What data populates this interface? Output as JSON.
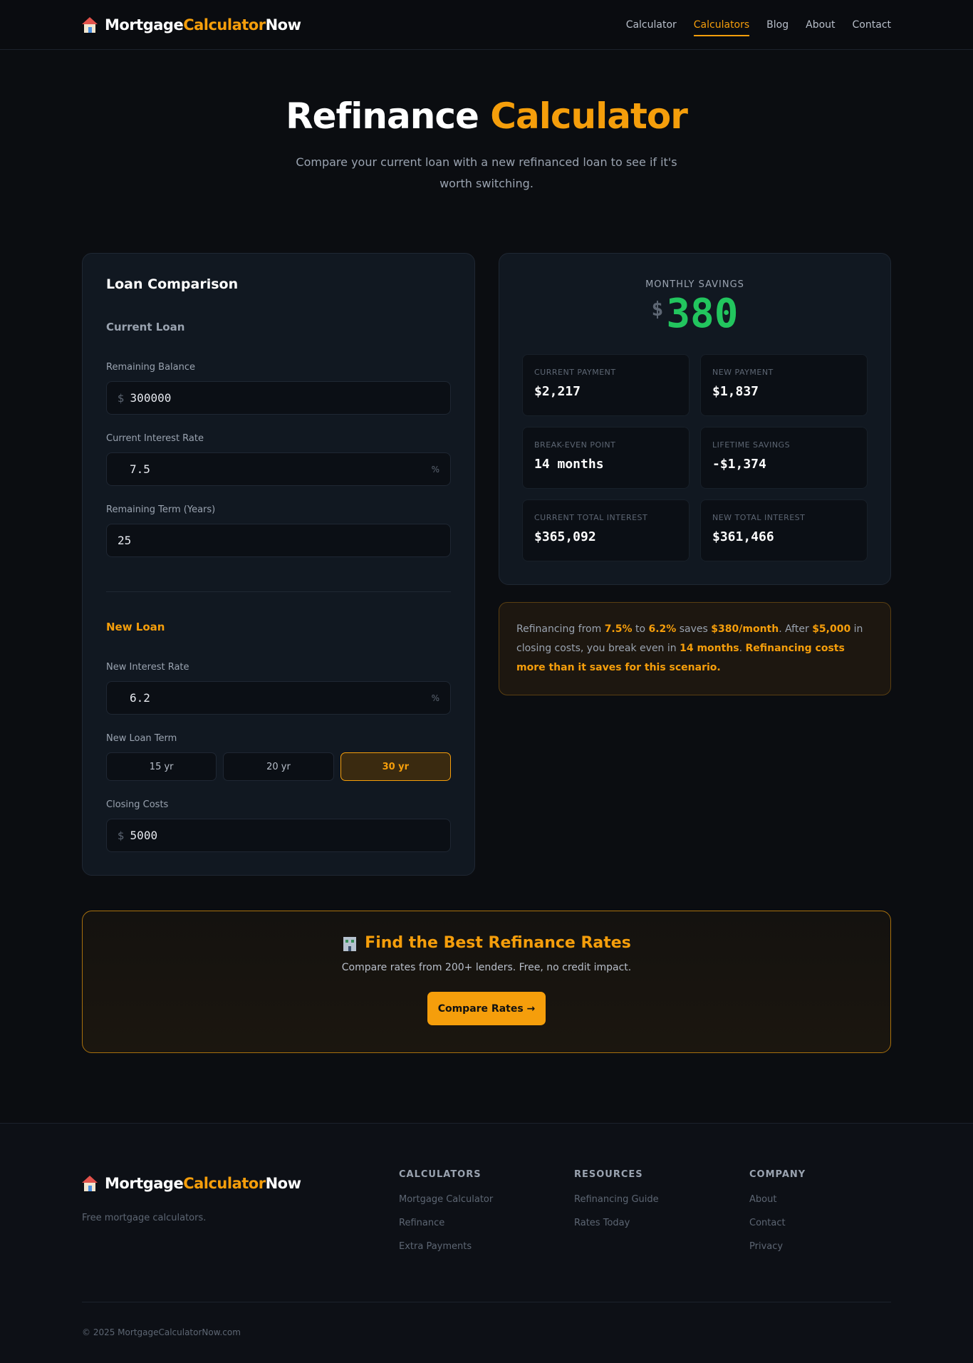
{
  "nav": {
    "brand_part1": "Mortgage",
    "brand_part2": "Calculator",
    "brand_part3": "Now",
    "links": [
      "Calculator",
      "Calculators",
      "Blog",
      "About",
      "Contact"
    ],
    "active": "Calculators"
  },
  "hero": {
    "title_part1": "Refinance",
    "title_part2": "Calculator",
    "subtitle": "Compare your current loan with a new refinanced loan to see if it's worth switching."
  },
  "form": {
    "title": "Loan Comparison",
    "current_loan": {
      "heading": "Current Loan",
      "balance_label": "Remaining Balance",
      "balance_prefix": "$",
      "balance_value": "300000",
      "rate_label": "Current Interest Rate",
      "rate_value": "7.5",
      "rate_suffix": "%",
      "term_label": "Remaining Term (Years)",
      "term_value": "25"
    },
    "new_loan": {
      "heading": "New Loan",
      "rate_label": "New Interest Rate",
      "rate_value": "6.2",
      "rate_suffix": "%",
      "term_label": "New Loan Term",
      "term_options": [
        "15 yr",
        "20 yr",
        "30 yr"
      ],
      "term_selected": "30 yr",
      "closing_label": "Closing Costs",
      "closing_prefix": "$",
      "closing_value": "5000"
    }
  },
  "results": {
    "monthly_savings_label": "MONTHLY SAVINGS",
    "monthly_savings_currency": "$",
    "monthly_savings_value": "380",
    "stats": [
      {
        "label": "CURRENT PAYMENT",
        "value": "$2,217"
      },
      {
        "label": "NEW PAYMENT",
        "value": "$1,837"
      },
      {
        "label": "BREAK-EVEN POINT",
        "value": "14 months"
      },
      {
        "label": "LIFETIME SAVINGS",
        "value": "-$1,374"
      },
      {
        "label": "CURRENT TOTAL INTEREST",
        "value": "$365,092"
      },
      {
        "label": "NEW TOTAL INTEREST",
        "value": "$361,466"
      }
    ]
  },
  "summary": {
    "t1": "Refinancing from ",
    "h1": "7.5%",
    "t2": " to ",
    "h2": "6.2%",
    "t3": " saves ",
    "h3": "$380/month",
    "t4": ". After ",
    "h4": "$5,000",
    "t5": " in closing costs, you break even in ",
    "h5": "14 months",
    "t6": ". ",
    "h6": "Refinancing costs more than it saves for this scenario."
  },
  "cta": {
    "title": "Find the Best Refinance Rates",
    "subtitle": "Compare rates from 200+ lenders. Free, no credit impact.",
    "button": "Compare Rates →"
  },
  "footer": {
    "tagline": "Free mortgage calculators.",
    "columns": [
      {
        "heading": "CALCULATORS",
        "links": [
          "Mortgage Calculator",
          "Refinance",
          "Extra Payments"
        ]
      },
      {
        "heading": "RESOURCES",
        "links": [
          "Refinancing Guide",
          "Rates Today"
        ]
      },
      {
        "heading": "COMPANY",
        "links": [
          "About",
          "Contact",
          "Privacy"
        ]
      }
    ],
    "copyright": "© 2025 MortgageCalculatorNow.com"
  },
  "colors": {
    "accent": "#f59e0b",
    "positive": "#22c55e",
    "background": "#0b0d11",
    "card": "#111821"
  }
}
